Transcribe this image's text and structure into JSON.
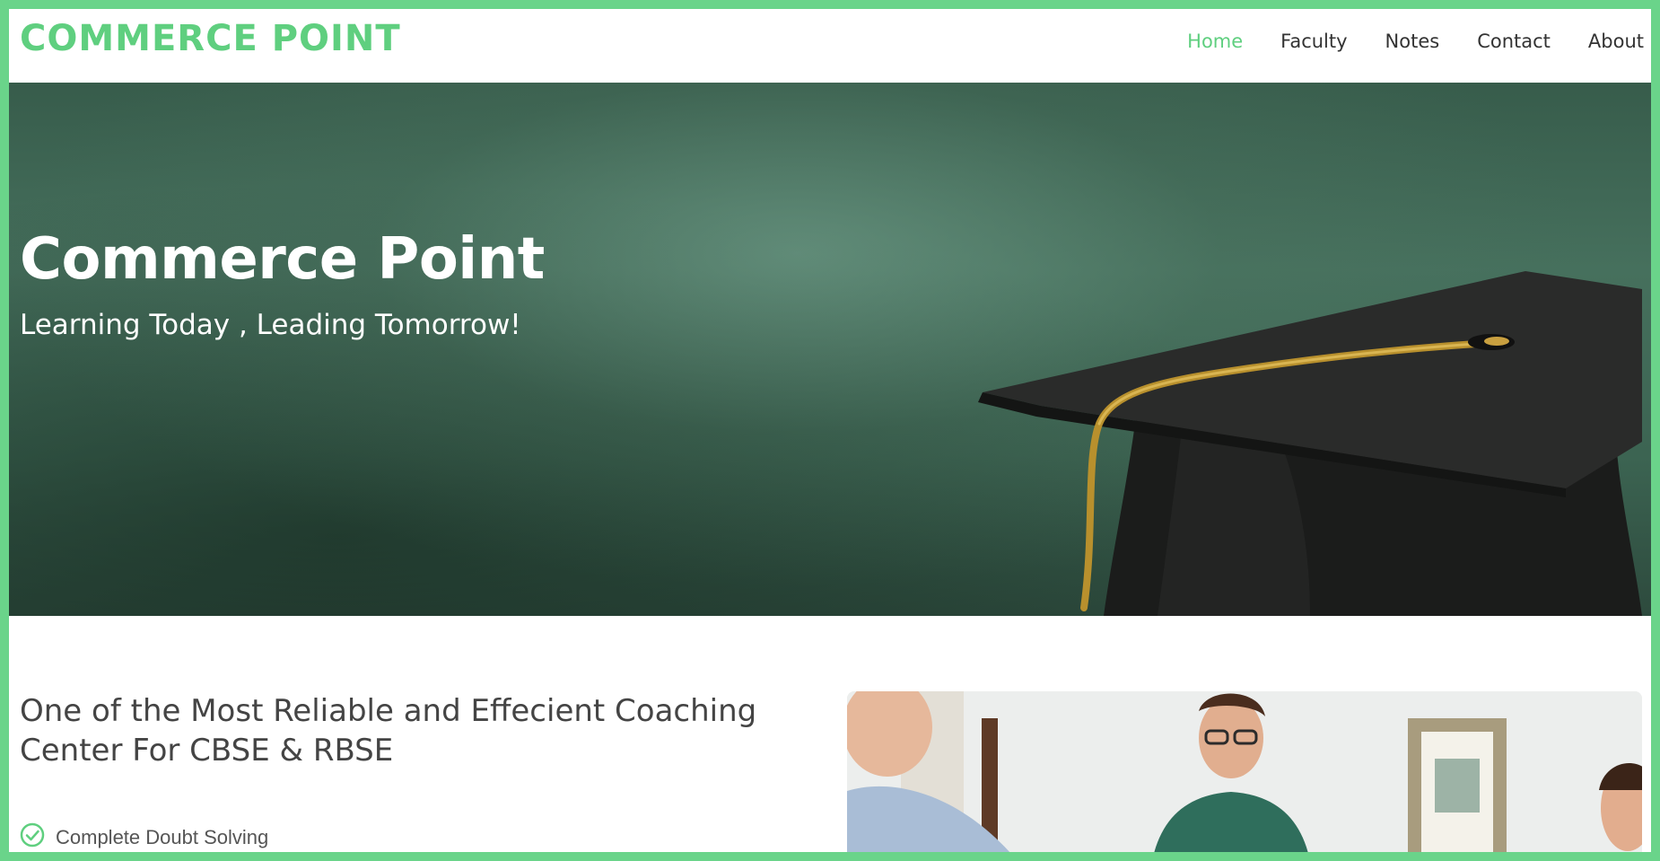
{
  "brand": {
    "name": "COMMERCE POINT"
  },
  "nav": {
    "items": [
      {
        "label": "Home",
        "active": true
      },
      {
        "label": "Faculty",
        "active": false
      },
      {
        "label": "Notes",
        "active": false
      },
      {
        "label": "Contact",
        "active": false
      },
      {
        "label": "About",
        "active": false
      }
    ]
  },
  "hero": {
    "title": "Commerce Point",
    "subtitle": "Learning Today , Leading Tomorrow!"
  },
  "intro": {
    "heading": "One of the Most Reliable and Effecient Coaching Center For CBSE & RBSE",
    "features": [
      "Complete Doubt Solving"
    ]
  },
  "colors": {
    "accent": "#6ad48a",
    "brand": "#5fcf7f",
    "nav_text": "#333333"
  }
}
